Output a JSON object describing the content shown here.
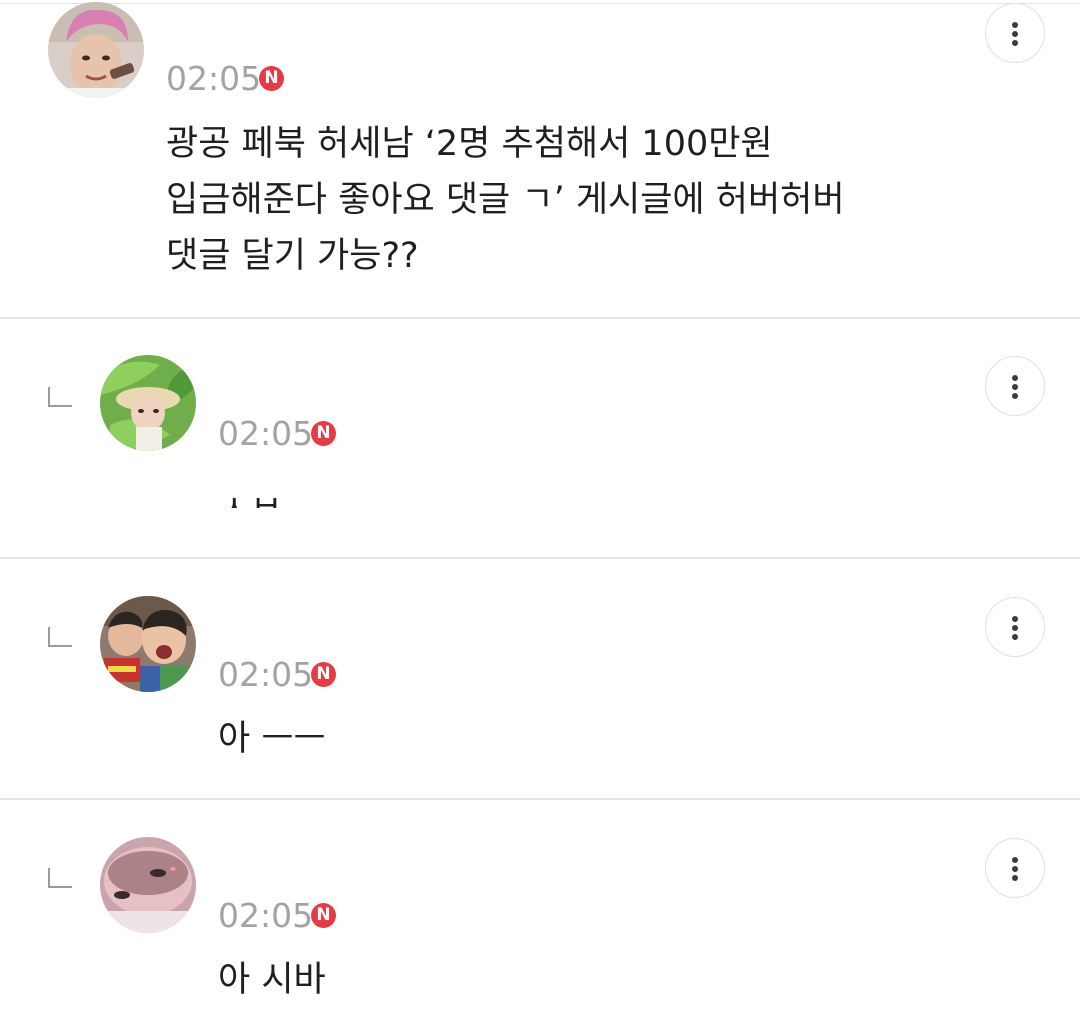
{
  "comments": [
    {
      "avatar": "pink-hair-person-avatar",
      "time": "02:05",
      "badge": "N",
      "text": "광공 페북 허세남 ‘2명 추첨해서 100만원\n입금해준다 좋아요 댓글 ㄱ’ 게시글에 허버허버\n댓글 달기 가능??",
      "is_reply": false
    },
    {
      "avatar": "leafy-hat-person-avatar",
      "time": "02:05",
      "badge": "N",
      "text": "ㅅㅂ",
      "is_reply": true
    },
    {
      "avatar": "crying-kid-avatar",
      "time": "02:05",
      "badge": "N",
      "text": "아 ㅡㅡ",
      "is_reply": true
    },
    {
      "avatar": "baby-face-avatar",
      "time": "02:05",
      "badge": "N",
      "text": "아 시바",
      "is_reply": true
    }
  ],
  "icons": {
    "more": "more-vertical-icon",
    "reply": "reply-arrow-icon"
  },
  "colors": {
    "badge": "#e53b44",
    "time": "#a3a3a3",
    "text": "#1f1f1f",
    "divider": "#e6e6e6"
  }
}
